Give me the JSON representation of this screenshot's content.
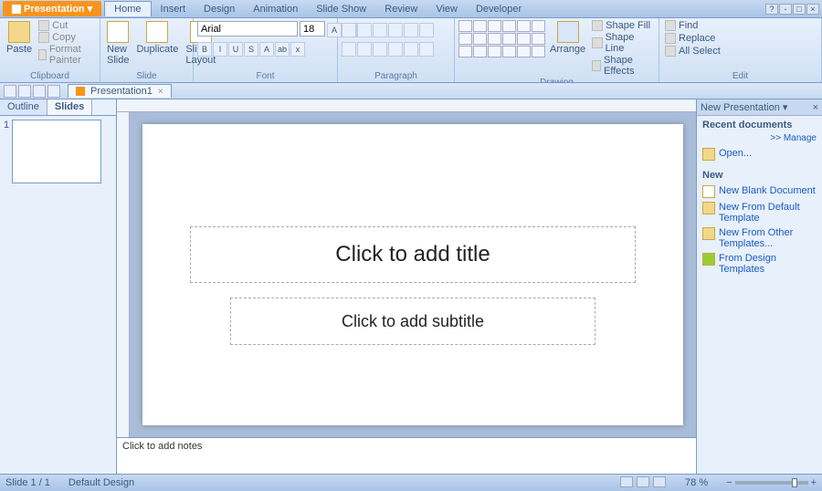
{
  "app": {
    "title": "Presentation",
    "dropdown": "▾"
  },
  "menu": {
    "tabs": [
      "Home",
      "Insert",
      "Design",
      "Animation",
      "Slide Show",
      "Review",
      "View",
      "Developer"
    ],
    "active": 0
  },
  "ribbon": {
    "clipboard": {
      "label": "Clipboard",
      "paste": "Paste",
      "cut": "Cut",
      "copy": "Copy",
      "format_painter": "Format Painter"
    },
    "slide": {
      "label": "Slide",
      "new_slide": "New\nSlide",
      "duplicate": "Duplicate",
      "layout": "Slide\nLayout"
    },
    "font": {
      "label": "Font",
      "name": "Arial",
      "size": "18"
    },
    "paragraph": {
      "label": "Paragraph"
    },
    "drawing": {
      "label": "Drawing",
      "arrange": "Arrange",
      "shape_fill": "Shape Fill",
      "shape_line": "Shape Line",
      "shape_effects": "Shape Effects"
    },
    "edit": {
      "label": "Edit",
      "find": "Find",
      "replace": "Replace",
      "select": "All Select"
    }
  },
  "document": {
    "tab_name": "Presentation1"
  },
  "leftpane": {
    "outline": "Outline",
    "slides": "Slides",
    "thumbs": [
      {
        "num": "1"
      }
    ]
  },
  "slide": {
    "title_placeholder": "Click to add title",
    "subtitle_placeholder": "Click to add subtitle"
  },
  "notes": {
    "placeholder": "Click to add notes"
  },
  "taskpane": {
    "title": "New Presentation",
    "recent_hdr": "Recent documents",
    "manage": ">> Manage",
    "open": "Open...",
    "new_hdr": "New",
    "items": [
      "New Blank Document",
      "New From Default Template",
      "New From Other Templates...",
      "From Design Templates"
    ]
  },
  "status": {
    "slide": "Slide 1 / 1",
    "design": "Default Design",
    "zoom": "78 %"
  }
}
